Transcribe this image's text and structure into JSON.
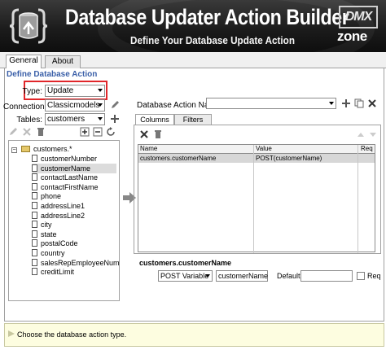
{
  "banner": {
    "title": "Database Updater Action Builder",
    "subtitle": "Define Your Database Update Action",
    "brand_top": "DMX",
    "brand_bottom": "zone"
  },
  "tabs": [
    {
      "label": "General",
      "active": true
    },
    {
      "label": "About",
      "active": false
    }
  ],
  "section_title": "Define Database Action",
  "form": {
    "type_label": "Type:",
    "type_value": "Update",
    "connection_label": "Connection:",
    "connection_value": "Classicmodels",
    "tables_label": "Tables:",
    "tables_value": "customers",
    "action_name_label": "Database Action Name:",
    "action_name_value": ""
  },
  "tree": {
    "root": "customers.*",
    "items": [
      "customerNumber",
      "customerName",
      "contactLastName",
      "contactFirstName",
      "phone",
      "addressLine1",
      "addressLine2",
      "city",
      "state",
      "postalCode",
      "country",
      "salesRepEmployeeNum",
      "creditLimit"
    ],
    "selected_index": 1
  },
  "inner_tabs": [
    {
      "label": "Columns",
      "active": true
    },
    {
      "label": "Filters",
      "active": false
    }
  ],
  "grid": {
    "headers": [
      "Name",
      "Value",
      "Req"
    ],
    "rows": [
      {
        "name": "customers.customerName",
        "value": "POST(customerName)",
        "req": ""
      }
    ]
  },
  "detail": {
    "field_title": "customers.customerName",
    "source_value": "POST Variable",
    "variable_value": "customerName",
    "default_label": "Default:",
    "default_value": "",
    "req_label": "Req",
    "req_checked": false
  },
  "hint": "Choose the database action type.",
  "colors": {
    "accent": "#3a5fa8",
    "highlight_border": "#e0262a",
    "hint_bg": "#fdfde0"
  }
}
